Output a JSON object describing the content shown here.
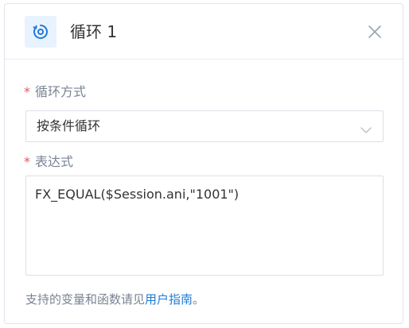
{
  "header": {
    "icon": "loop-icon",
    "title": "循环 1",
    "close_icon": "close-icon"
  },
  "fields": {
    "loop_mode": {
      "required_mark": "*",
      "label": "循环方式",
      "value": "按条件循环",
      "chevron_icon": "chevron-down-icon"
    },
    "expression": {
      "required_mark": "*",
      "label": "表达式",
      "value": "FX_EQUAL($Session.ani,\"1001\")"
    }
  },
  "hint": {
    "text": "支持的变量和函数请见",
    "link": "用户指南",
    "suffix": "。"
  },
  "colors": {
    "accent": "#1f7ad6",
    "required": "#e8545c",
    "icon_bg": "#e7f3ff"
  }
}
